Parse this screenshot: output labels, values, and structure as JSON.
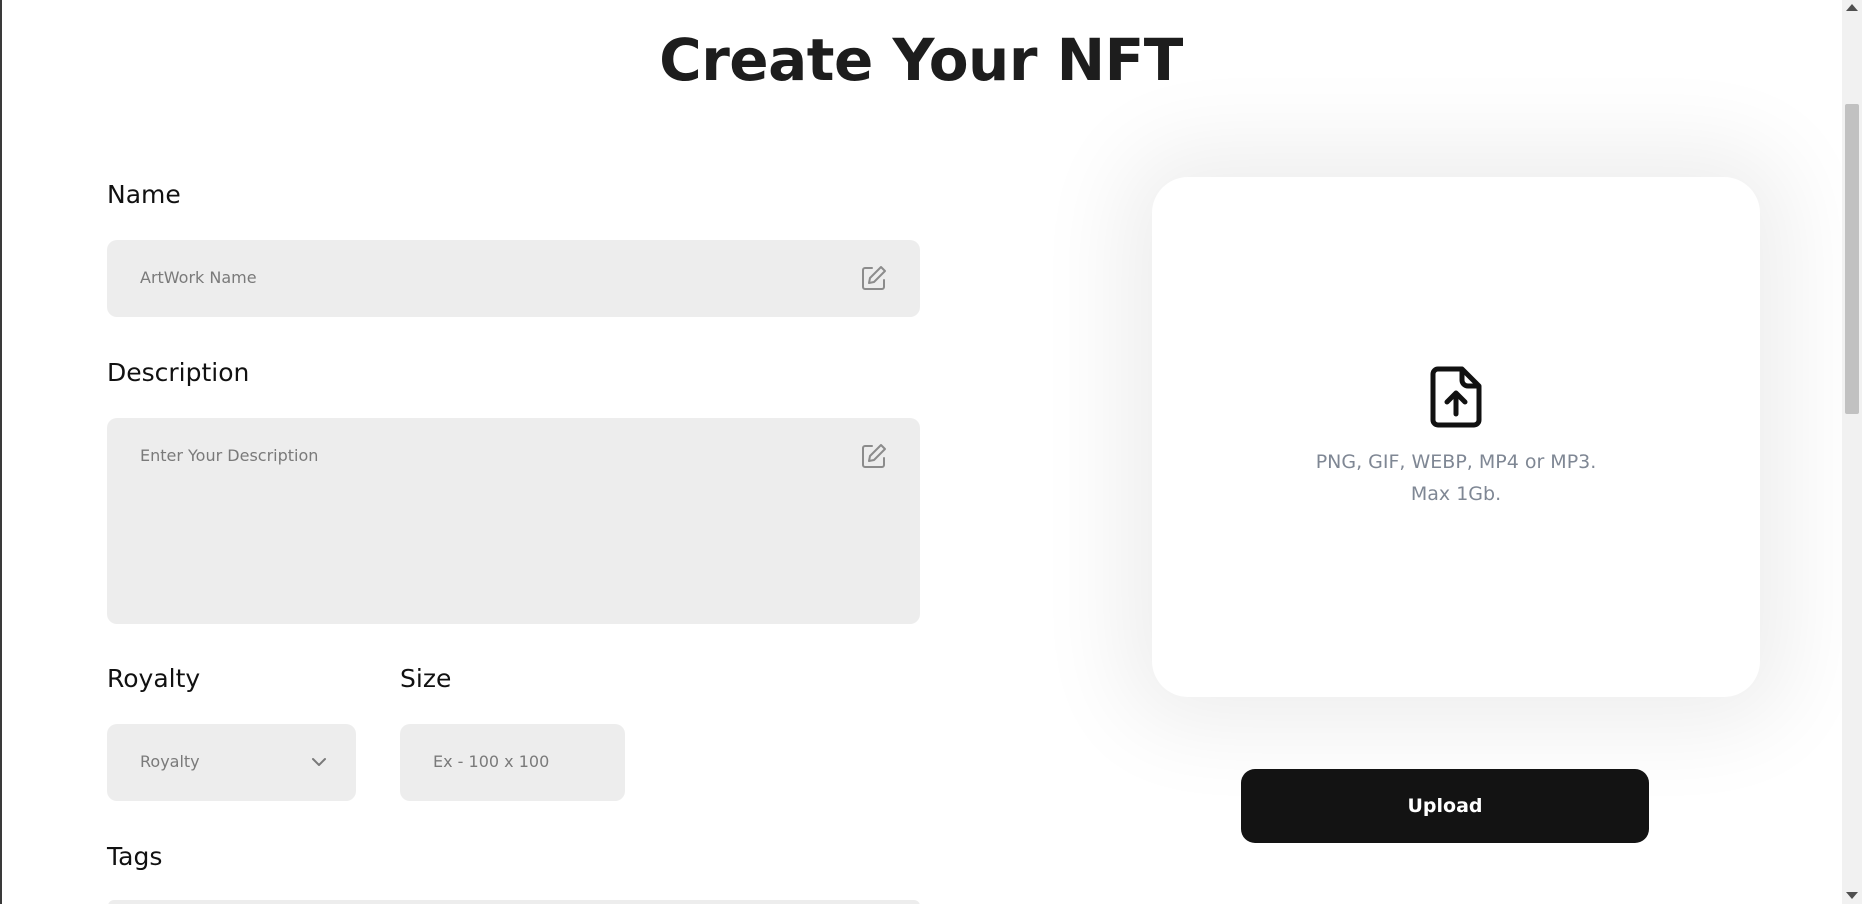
{
  "page": {
    "title": "Create Your NFT"
  },
  "form": {
    "name": {
      "label": "Name",
      "placeholder": "ArtWork Name",
      "value": ""
    },
    "description": {
      "label": "Description",
      "placeholder": "Enter Your Description",
      "value": ""
    },
    "royalty": {
      "label": "Royalty",
      "selected": "Royalty"
    },
    "size": {
      "label": "Size",
      "placeholder": "Ex - 100 x 100",
      "value": ""
    },
    "tags": {
      "label": "Tags"
    }
  },
  "preview": {
    "hint": "PNG, GIF, WEBP, MP4 or MP3. Max 1Gb.",
    "icon": "file-upload-icon"
  },
  "actions": {
    "upload_label": "Upload"
  },
  "icons": {
    "edit": "edit-icon",
    "chevron": "chevron-down-icon"
  },
  "colors": {
    "input_bg": "#ededed",
    "button_bg": "#131313",
    "hint_text": "#7f8794"
  }
}
